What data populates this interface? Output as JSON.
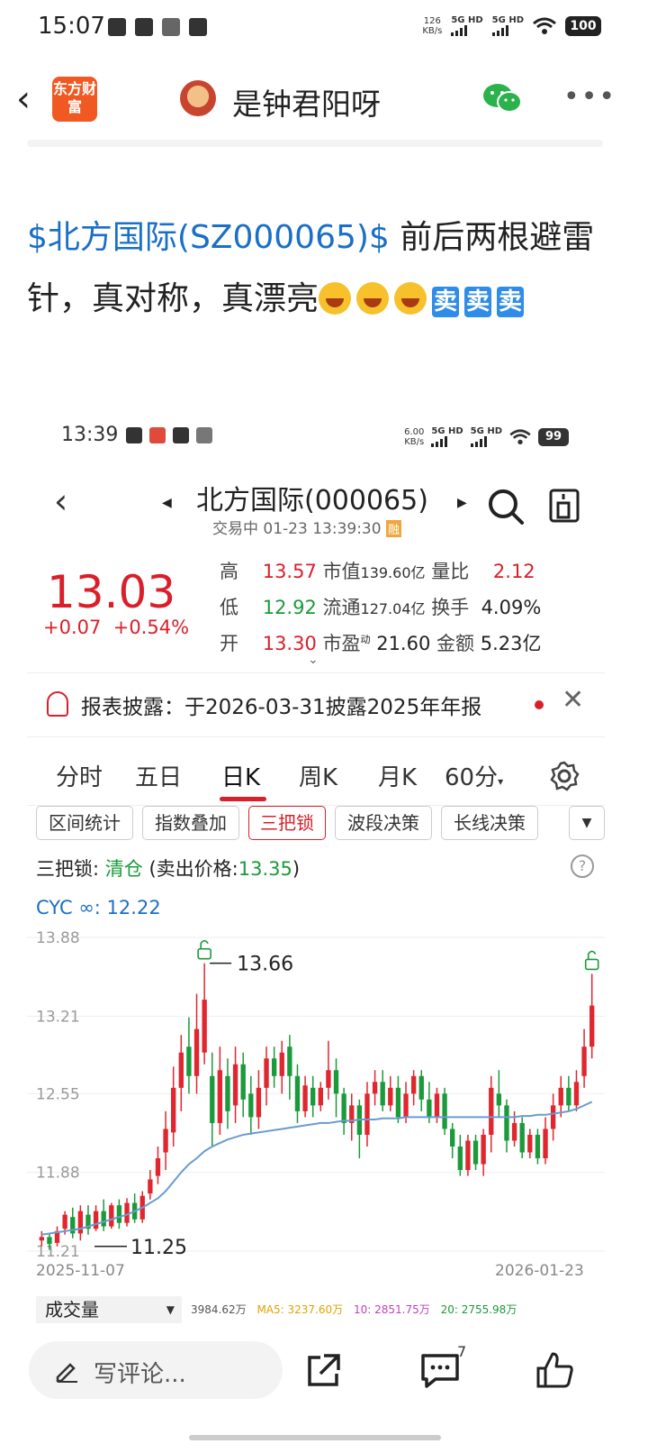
{
  "status_bar": {
    "time": "15:07",
    "speed": "126",
    "speed_unit": "KB/s",
    "sim1": "5G HD",
    "sim2": "5G HD",
    "battery": "100"
  },
  "nav": {
    "app_logo": "东方财富",
    "title": "是钟君阳呀"
  },
  "post": {
    "stock_link": "$北方国际(SZ000065)$",
    "text": " 前后两根避雷针，真对称，真漂亮",
    "emoji": [
      "grinning-face",
      "grinning-face",
      "grinning-face"
    ],
    "tags": [
      "卖",
      "卖",
      "卖"
    ]
  },
  "screenshot": {
    "status_bar": {
      "time": "13:39",
      "speed": "6.00",
      "speed_unit": "KB/s",
      "sim1": "5G HD",
      "sim2": "5G HD",
      "battery": "99"
    },
    "header": {
      "title": "北方国际(000065)",
      "subtitle": "交易中 01-23 13:39:30",
      "badge": "融"
    },
    "quote": {
      "price": "13.03",
      "change": "+0.07",
      "change_pct": "+0.54%",
      "rows": [
        {
          "l1": "高",
          "v1": "13.57",
          "l2": "市值",
          "v2": "139.60亿",
          "l3": "量比",
          "v3": "2.12"
        },
        {
          "l1": "低",
          "v1": "12.92",
          "l2": "流通",
          "v2": "127.04亿",
          "l3": "换手",
          "v3": "4.09%"
        },
        {
          "l1": "开",
          "v1": "13.30",
          "l2": "市盈",
          "l2_sup": "动",
          "v2": "21.60",
          "l3": "金额",
          "v3": "5.23亿"
        }
      ]
    },
    "notice": {
      "text": "报表披露：于2026-03-31披露2025年年报"
    },
    "period_tabs": [
      "分时",
      "五日",
      "日K",
      "周K",
      "月K",
      "60分"
    ],
    "active_period": "日K",
    "tools": [
      "区间统计",
      "指数叠加",
      "三把锁",
      "波段决策",
      "长线决策"
    ],
    "active_tool": "三把锁",
    "lock_status": {
      "label": "三把锁: ",
      "action": "清仓",
      "detail_prefix": " (卖出价格:",
      "price": "13.35",
      "detail_suffix": ")"
    },
    "cyc": "CYC ∞: 12.22",
    "volume": {
      "selector": "成交量",
      "total": "3984.62万",
      "ma5": "MA5: 3237.60万",
      "ma10": "10: 2851.75万",
      "ma20": "20: 2755.98万"
    }
  },
  "chart_data": {
    "type": "candlestick",
    "y_ticks": [
      "13.88",
      "13.21",
      "12.55",
      "11.88",
      "11.21"
    ],
    "ylim": [
      11.21,
      13.88
    ],
    "x_start": "2025-11-07",
    "x_end": "2026-01-23",
    "annotations": [
      {
        "label": "13.66",
        "value": 13.66
      },
      {
        "label": "11.25",
        "value": 11.25
      }
    ],
    "candles": [
      [
        11.3,
        11.33,
        11.25,
        11.38
      ],
      [
        11.33,
        11.27,
        11.22,
        11.36
      ],
      [
        11.28,
        11.38,
        11.25,
        11.42
      ],
      [
        11.4,
        11.52,
        11.35,
        11.55
      ],
      [
        11.5,
        11.36,
        11.32,
        11.58
      ],
      [
        11.36,
        11.55,
        11.3,
        11.6
      ],
      [
        11.52,
        11.4,
        11.35,
        11.6
      ],
      [
        11.4,
        11.55,
        11.38,
        11.6
      ],
      [
        11.55,
        11.42,
        11.38,
        11.65
      ],
      [
        11.42,
        11.6,
        11.4,
        11.62
      ],
      [
        11.6,
        11.45,
        11.4,
        11.65
      ],
      [
        11.45,
        11.62,
        11.42,
        11.66
      ],
      [
        11.62,
        11.48,
        11.45,
        11.7
      ],
      [
        11.48,
        11.68,
        11.45,
        11.72
      ],
      [
        11.7,
        11.82,
        11.65,
        11.9
      ],
      [
        11.85,
        12.0,
        11.78,
        12.1
      ],
      [
        12.05,
        12.25,
        11.9,
        12.4
      ],
      [
        12.22,
        12.6,
        12.1,
        12.78
      ],
      [
        12.6,
        12.9,
        12.4,
        13.05
      ],
      [
        12.95,
        12.7,
        12.55,
        13.2
      ],
      [
        12.7,
        13.1,
        12.55,
        13.4
      ],
      [
        12.9,
        13.35,
        12.8,
        13.66
      ],
      [
        12.7,
        12.3,
        12.1,
        12.9
      ],
      [
        12.3,
        12.75,
        12.2,
        12.95
      ],
      [
        12.7,
        12.4,
        12.25,
        12.85
      ],
      [
        12.45,
        12.8,
        12.3,
        12.95
      ],
      [
        12.8,
        12.5,
        12.35,
        12.9
      ],
      [
        12.55,
        12.35,
        12.2,
        12.7
      ],
      [
        12.35,
        12.6,
        12.25,
        12.75
      ],
      [
        12.6,
        12.85,
        12.45,
        12.95
      ],
      [
        12.85,
        12.7,
        12.6,
        12.95
      ],
      [
        12.7,
        12.9,
        12.55,
        13.0
      ],
      [
        12.95,
        12.7,
        12.5,
        13.05
      ],
      [
        12.7,
        12.4,
        12.3,
        12.8
      ],
      [
        12.4,
        12.62,
        12.35,
        12.7
      ],
      [
        12.6,
        12.45,
        12.35,
        12.7
      ],
      [
        12.45,
        12.6,
        12.4,
        12.65
      ],
      [
        12.6,
        12.75,
        12.5,
        13.0
      ],
      [
        12.75,
        12.55,
        12.35,
        12.85
      ],
      [
        12.55,
        12.3,
        12.2,
        12.6
      ],
      [
        12.3,
        12.45,
        12.15,
        12.55
      ],
      [
        12.45,
        12.2,
        12.0,
        12.5
      ],
      [
        12.2,
        12.55,
        12.1,
        12.65
      ],
      [
        12.55,
        12.65,
        12.45,
        12.75
      ],
      [
        12.65,
        12.45,
        12.4,
        12.75
      ],
      [
        12.45,
        12.6,
        12.4,
        12.7
      ],
      [
        12.6,
        12.35,
        12.3,
        12.7
      ],
      [
        12.35,
        12.55,
        12.3,
        12.65
      ],
      [
        12.55,
        12.7,
        12.45,
        12.75
      ],
      [
        12.7,
        12.5,
        12.4,
        12.75
      ],
      [
        12.5,
        12.35,
        12.3,
        12.65
      ],
      [
        12.35,
        12.55,
        12.3,
        12.6
      ],
      [
        12.55,
        12.25,
        12.2,
        12.6
      ],
      [
        12.25,
        12.1,
        12.0,
        12.3
      ],
      [
        12.1,
        11.9,
        11.85,
        12.2
      ],
      [
        11.9,
        12.15,
        11.85,
        12.2
      ],
      [
        12.15,
        11.95,
        11.9,
        12.2
      ],
      [
        11.95,
        12.2,
        11.85,
        12.25
      ],
      [
        12.2,
        12.6,
        12.05,
        12.7
      ],
      [
        12.55,
        12.45,
        12.35,
        12.75
      ],
      [
        12.45,
        12.15,
        12.05,
        12.5
      ],
      [
        12.15,
        12.3,
        12.1,
        12.4
      ],
      [
        12.3,
        12.05,
        12.0,
        12.35
      ],
      [
        12.05,
        12.2,
        12.0,
        12.25
      ],
      [
        12.2,
        12.0,
        11.95,
        12.25
      ],
      [
        12.0,
        12.25,
        11.95,
        12.35
      ],
      [
        12.25,
        12.45,
        12.15,
        12.55
      ],
      [
        12.45,
        12.6,
        12.35,
        12.7
      ],
      [
        12.6,
        12.45,
        12.4,
        12.7
      ],
      [
        12.45,
        12.65,
        12.4,
        12.75
      ],
      [
        12.7,
        12.95,
        12.6,
        13.1
      ],
      [
        12.95,
        13.3,
        12.85,
        13.57
      ]
    ],
    "ma_line": [
      11.35,
      11.36,
      11.37,
      11.38,
      11.39,
      11.4,
      11.42,
      11.44,
      11.46,
      11.48,
      11.5,
      11.52,
      11.55,
      11.58,
      11.62,
      11.66,
      11.72,
      11.8,
      11.88,
      11.95,
      12.0,
      12.06,
      12.1,
      12.13,
      12.16,
      12.18,
      12.2,
      12.21,
      12.22,
      12.23,
      12.24,
      12.25,
      12.26,
      12.27,
      12.28,
      12.29,
      12.3,
      12.3,
      12.31,
      12.32,
      12.32,
      12.33,
      12.33,
      12.33,
      12.34,
      12.34,
      12.34,
      12.35,
      12.35,
      12.35,
      12.35,
      12.35,
      12.35,
      12.35,
      12.35,
      12.35,
      12.35,
      12.35,
      12.35,
      12.35,
      12.35,
      12.35,
      12.36,
      12.36,
      12.37,
      12.37,
      12.38,
      12.39,
      12.4,
      12.42,
      12.45,
      12.48
    ]
  }
}
